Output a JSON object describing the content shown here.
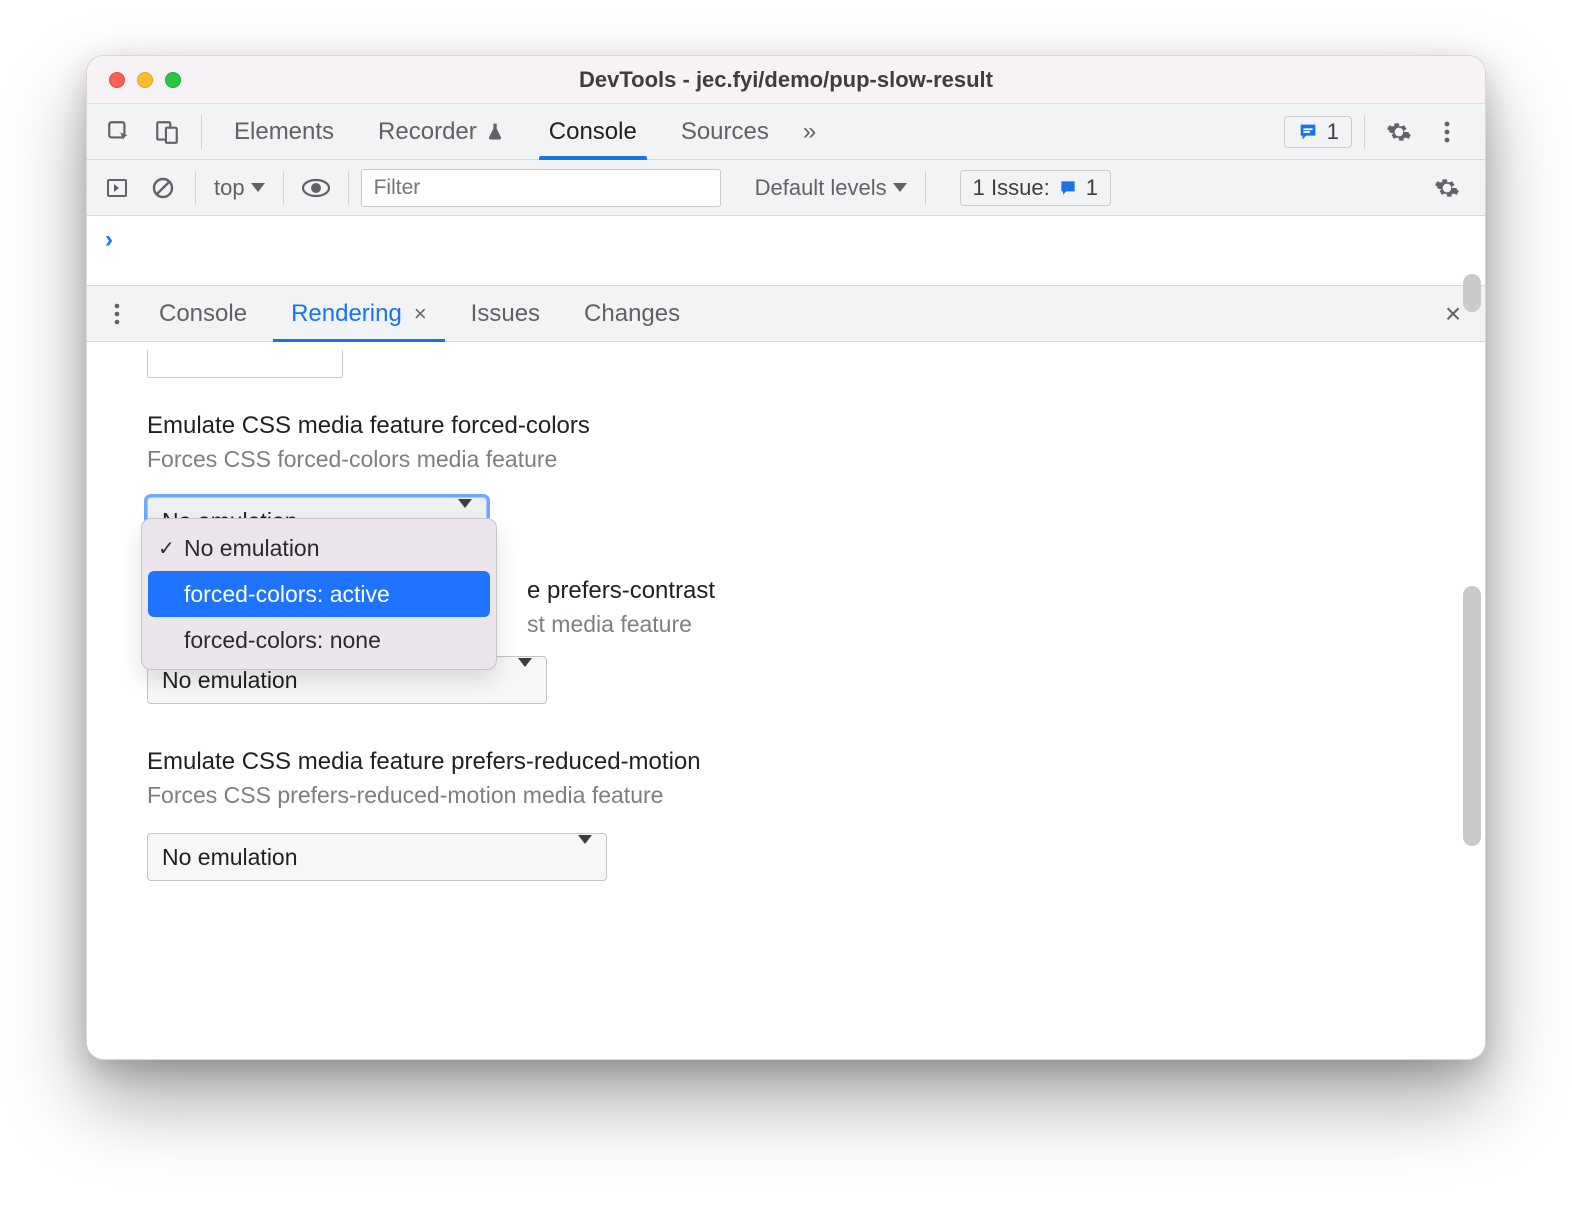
{
  "window": {
    "title": "DevTools - jec.fyi/demo/pup-slow-result"
  },
  "toolbar": {
    "tabs": {
      "elements": "Elements",
      "recorder": "Recorder",
      "console": "Console",
      "sources": "Sources"
    },
    "more_glyph": "»",
    "issue_count": "1"
  },
  "consolebar": {
    "scope": "top",
    "filter_placeholder": "Filter",
    "levels": "Default levels",
    "issues_label": "1 Issue:",
    "issues_count": "1"
  },
  "prompt": {
    "glyph": "›"
  },
  "drawer": {
    "tabs": {
      "console": "Console",
      "rendering": "Rendering",
      "issues": "Issues",
      "changes": "Changes"
    },
    "close_glyph": "×"
  },
  "rendering": {
    "forced_colors": {
      "title": "Emulate CSS media feature forced-colors",
      "desc": "Forces CSS forced-colors media feature",
      "selected": "No emulation",
      "options": {
        "none_emu": "No emulation",
        "active": "forced-colors: active",
        "none": "forced-colors: none"
      }
    },
    "prefers_contrast": {
      "title_tail": "e prefers-contrast",
      "desc_tail": "st media feature",
      "selected": "No emulation"
    },
    "prefers_reduced_motion": {
      "title": "Emulate CSS media feature prefers-reduced-motion",
      "desc": "Forces CSS prefers-reduced-motion media feature",
      "selected": "No emulation"
    }
  }
}
